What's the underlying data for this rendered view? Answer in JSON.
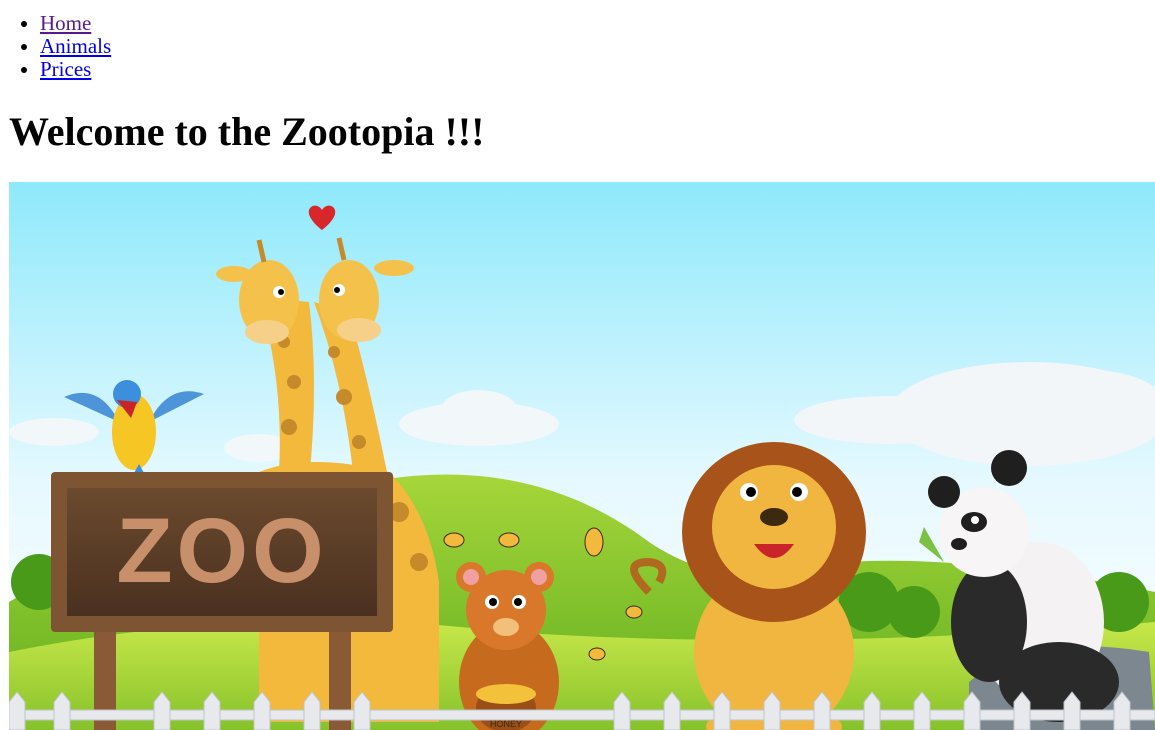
{
  "nav": {
    "items": [
      {
        "label": "Home"
      },
      {
        "label": "Animals"
      },
      {
        "label": "Prices"
      }
    ]
  },
  "page_title": "Welcome to the Zootopia !!!",
  "hero": {
    "sign_text": "ZOO",
    "honey_label": "HONEY"
  }
}
